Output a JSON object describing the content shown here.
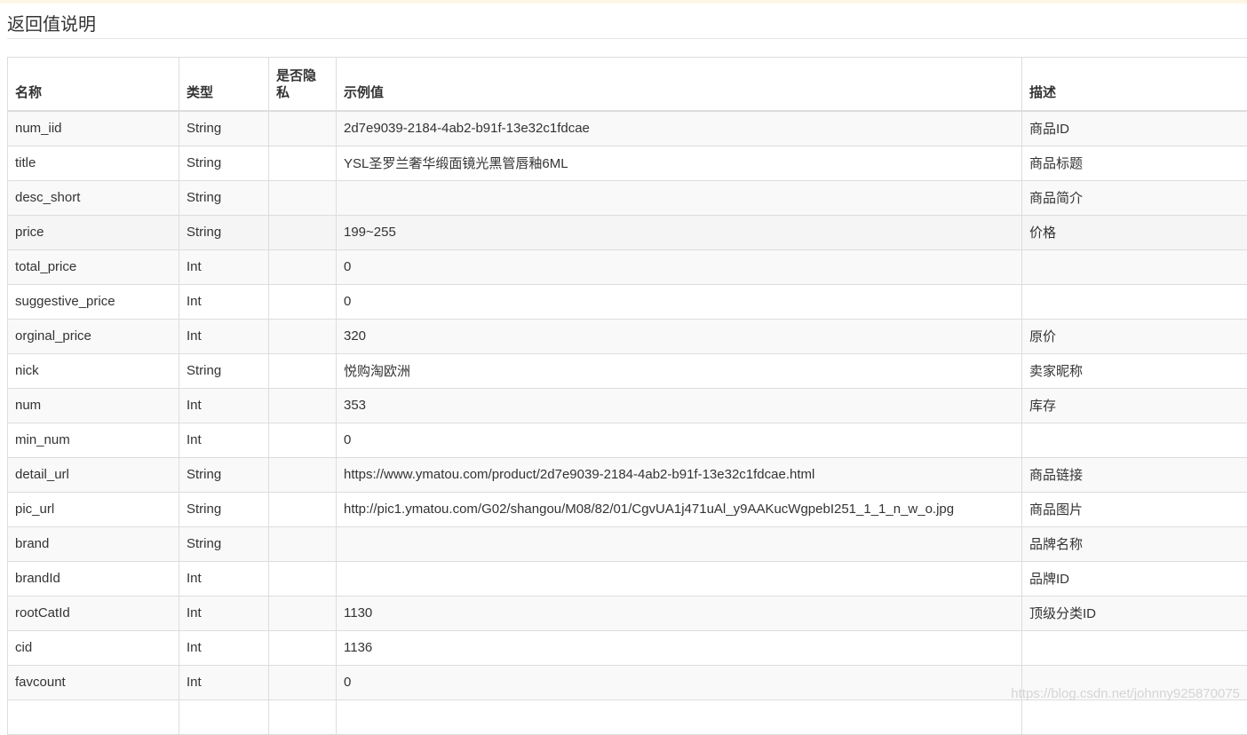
{
  "section": {
    "title": "返回值说明"
  },
  "table": {
    "headers": {
      "name": "名称",
      "type": "类型",
      "private": "是否隐私",
      "example": "示例值",
      "desc": "描述"
    },
    "rows": [
      {
        "name": "num_iid",
        "type": "String",
        "private": "",
        "example": "2d7e9039-2184-4ab2-b91f-13e32c1fdcae",
        "desc": "商品ID"
      },
      {
        "name": "title",
        "type": "String",
        "private": "",
        "example": "YSL圣罗兰奢华缎面镜光黑管唇釉6ML",
        "desc": "商品标题"
      },
      {
        "name": "desc_short",
        "type": "String",
        "private": "",
        "example": "",
        "desc": "商品简介"
      },
      {
        "name": "price",
        "type": "String",
        "private": "",
        "example": "199~255",
        "desc": "价格"
      },
      {
        "name": "total_price",
        "type": "Int",
        "private": "",
        "example": "0",
        "desc": ""
      },
      {
        "name": "suggestive_price",
        "type": "Int",
        "private": "",
        "example": "0",
        "desc": ""
      },
      {
        "name": "orginal_price",
        "type": "Int",
        "private": "",
        "example": "320",
        "desc": "原价"
      },
      {
        "name": "nick",
        "type": "String",
        "private": "",
        "example": "悦购淘欧洲",
        "desc": "卖家昵称"
      },
      {
        "name": "num",
        "type": "Int",
        "private": "",
        "example": "353",
        "desc": "库存"
      },
      {
        "name": "min_num",
        "type": "Int",
        "private": "",
        "example": "0",
        "desc": ""
      },
      {
        "name": "detail_url",
        "type": "String",
        "private": "",
        "example": "https://www.ymatou.com/product/2d7e9039-2184-4ab2-b91f-13e32c1fdcae.html",
        "desc": "商品链接"
      },
      {
        "name": "pic_url",
        "type": "String",
        "private": "",
        "example": "http://pic1.ymatou.com/G02/shangou/M08/82/01/CgvUA1j471uAl_y9AAKucWgpebI251_1_1_n_w_o.jpg",
        "desc": "商品图片"
      },
      {
        "name": "brand",
        "type": "String",
        "private": "",
        "example": "",
        "desc": "品牌名称"
      },
      {
        "name": "brandId",
        "type": "Int",
        "private": "",
        "example": "",
        "desc": "品牌ID"
      },
      {
        "name": "rootCatId",
        "type": "Int",
        "private": "",
        "example": "1130",
        "desc": "顶级分类ID"
      },
      {
        "name": "cid",
        "type": "Int",
        "private": "",
        "example": "1136",
        "desc": ""
      },
      {
        "name": "favcount",
        "type": "Int",
        "private": "",
        "example": "0",
        "desc": ""
      },
      {
        "name": "",
        "type": "",
        "private": "",
        "example": "",
        "desc": ""
      }
    ]
  },
  "watermark": "https://blog.csdn.net/johnny925870075"
}
